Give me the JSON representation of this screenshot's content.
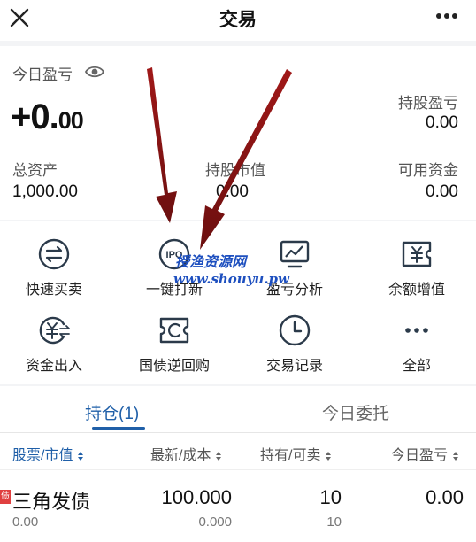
{
  "header": {
    "title": "交易"
  },
  "summary": {
    "today_pnl_label": "今日盈亏",
    "today_pnl_int": "+0.",
    "today_pnl_dec": "00",
    "holding_pnl_label": "持股盈亏",
    "holding_pnl_value": "0.00",
    "total_assets_label": "总资产",
    "total_assets_value": "1,000.00",
    "market_value_label": "持股市值",
    "market_value_value": "0.00",
    "available_label": "可用资金",
    "available_value": "0.00"
  },
  "actions": [
    {
      "label": "快速买卖",
      "icon": "swap-icon"
    },
    {
      "label": "一键打新",
      "icon": "ipo-icon"
    },
    {
      "label": "盈亏分析",
      "icon": "chart-icon"
    },
    {
      "label": "余额增值",
      "icon": "yen-ticket-icon"
    },
    {
      "label": "资金出入",
      "icon": "yen-transfer-icon"
    },
    {
      "label": "国债逆回购",
      "icon": "reverse-repo-icon"
    },
    {
      "label": "交易记录",
      "icon": "clock-icon"
    },
    {
      "label": "全部",
      "icon": "more-dots-icon"
    }
  ],
  "tabs": [
    {
      "label": "持仓(1)",
      "active": true
    },
    {
      "label": "今日委托",
      "active": false
    }
  ],
  "table": {
    "columns": [
      "股票/市值",
      "最新/成本",
      "持有/可卖",
      "今日盈亏"
    ],
    "rows": [
      {
        "tag": "债",
        "name": "三角发债",
        "market_value": "0.00",
        "latest": "100.000",
        "cost": "0.000",
        "hold": "10",
        "sellable": "10",
        "today_pnl": "0.00"
      }
    ]
  },
  "watermark": {
    "line1": "授渔资源网",
    "line2": "www.shouyu.pw"
  },
  "colors": {
    "accent": "#1f5fa8",
    "icon": "#2b3a4a",
    "arrow": "#8b1a1a",
    "tag": "#e04040"
  }
}
